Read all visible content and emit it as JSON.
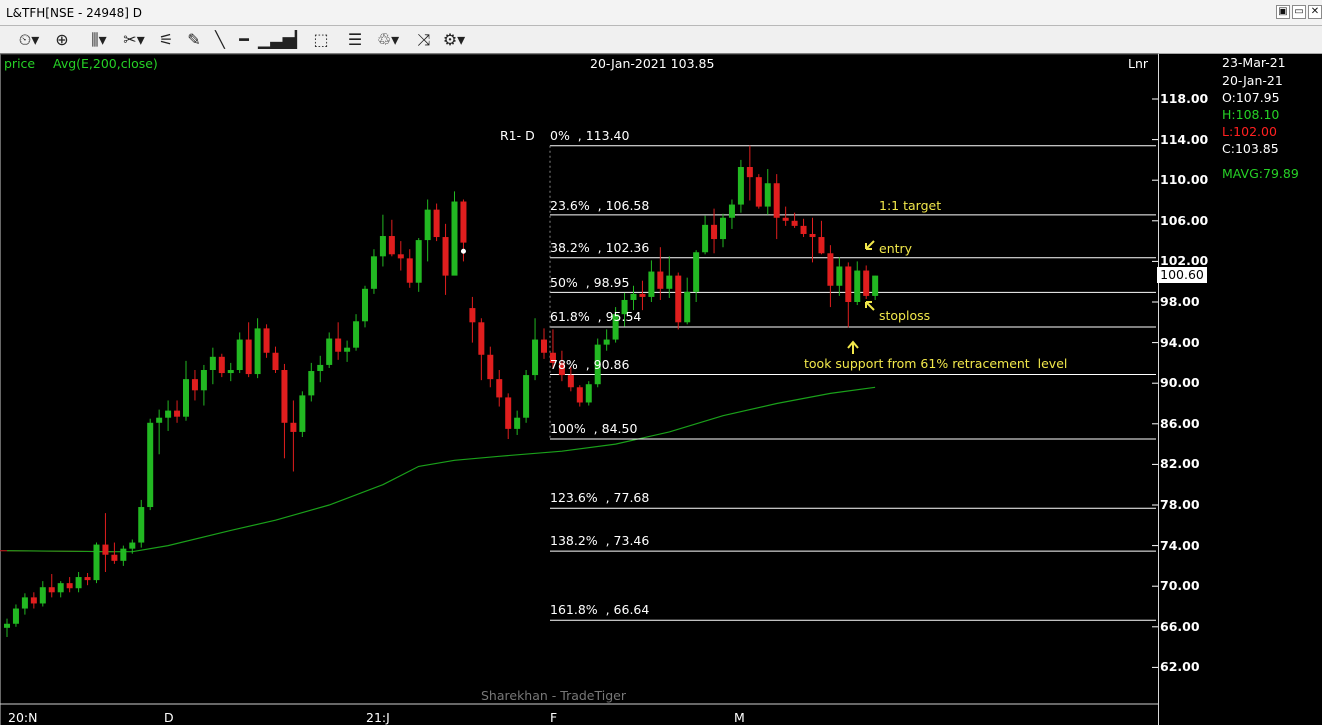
{
  "window": {
    "title": "L&TFH[NSE - 24948] D",
    "buttons": {
      "restore": "▣",
      "minimize": "▭",
      "close": "✕"
    }
  },
  "toolbar": {
    "icons": [
      "chart-style-icon",
      "crosshair-icon",
      "bar-type-icon",
      "line-tools-icon",
      "fibonacci-icon",
      "pen-icon",
      "segment-icon",
      "volume-bars-icon",
      "vertical-line-icon",
      "3d-box-icon",
      "horizontal-lines-icon",
      "draw-tools-icon",
      "compare-icon",
      "settings-gear-icon"
    ]
  },
  "header": {
    "price_label": "price",
    "indicator_label": "Avg(E,200,close)",
    "cursor_info": "20-Jan-2021 103.85",
    "scale_mode": "Lnr"
  },
  "info_panel": {
    "date1": "23-Mar-21",
    "date2": "20-Jan-21",
    "open": "O:107.95",
    "high": "H:108.10",
    "low": "L:102.00",
    "close": "C:103.85",
    "mavg": "MAVG:79.89"
  },
  "current_price_tag": "100.60",
  "watermark": "Sharekhan - TradeTiger",
  "colors": {
    "up": "#22b822",
    "down": "#e01e1e",
    "mavg": "#1aa01a",
    "annotation": "#f2e84b",
    "fib_line": "#ffffff"
  },
  "chart_data": {
    "type": "candlestick",
    "symbol": "L&TFH",
    "y_axis": {
      "ticks": [
        "118.00",
        "114.00",
        "110.00",
        "106.00",
        "102.00",
        "98.00",
        "94.00",
        "90.00",
        "86.00",
        "82.00",
        "78.00",
        "74.00",
        "70.00",
        "66.00",
        "62.00"
      ],
      "ylim": [
        59,
        122
      ]
    },
    "x_axis": {
      "labels": [
        "20:N",
        "D",
        "21:J",
        "F",
        "M"
      ]
    },
    "fibonacci": {
      "label": "R1- D",
      "levels": [
        {
          "text": "0%  , 113.40",
          "value": 113.4
        },
        {
          "text": "23.6%  , 106.58",
          "value": 106.58
        },
        {
          "text": "38.2%  , 102.36",
          "value": 102.36
        },
        {
          "text": "50%  , 98.95",
          "value": 98.95
        },
        {
          "text": "61.8%  , 95.54",
          "value": 95.54
        },
        {
          "text": "78%  , 90.86",
          "value": 90.86
        },
        {
          "text": "100%  , 84.50",
          "value": 84.5
        },
        {
          "text": "123.6%  , 77.68",
          "value": 77.68
        },
        {
          "text": "138.2%  , 73.46",
          "value": 73.46
        },
        {
          "text": "161.8%  , 66.64",
          "value": 66.64
        }
      ]
    },
    "annotations": [
      {
        "text": "1:1 target",
        "value": 106.58
      },
      {
        "text": "entry",
        "value": 102.36
      },
      {
        "text": "stoploss",
        "value": 95.54
      },
      {
        "text": "took support from 61% retracement  level",
        "value": 93.0
      }
    ],
    "candles": [
      [
        65.9,
        66.8,
        65.0,
        66.3
      ],
      [
        66.3,
        68.2,
        66.0,
        67.8
      ],
      [
        67.8,
        69.3,
        67.2,
        68.9
      ],
      [
        68.9,
        69.4,
        67.8,
        68.3
      ],
      [
        68.3,
        70.5,
        68.0,
        69.9
      ],
      [
        69.9,
        71.2,
        68.9,
        69.4
      ],
      [
        69.4,
        70.5,
        68.9,
        70.3
      ],
      [
        70.3,
        70.9,
        69.4,
        69.8
      ],
      [
        69.8,
        71.4,
        69.4,
        70.9
      ],
      [
        70.9,
        71.3,
        70.1,
        70.6
      ],
      [
        70.6,
        74.3,
        70.3,
        74.1
      ],
      [
        74.1,
        77.2,
        71.4,
        73.1
      ],
      [
        73.1,
        74.3,
        72.2,
        72.5
      ],
      [
        72.5,
        74.0,
        72.0,
        73.7
      ],
      [
        73.7,
        74.6,
        73.2,
        74.3
      ],
      [
        74.3,
        78.5,
        73.8,
        77.8
      ],
      [
        77.8,
        86.5,
        77.5,
        86.1
      ],
      [
        86.1,
        87.4,
        83.0,
        86.6
      ],
      [
        86.6,
        88.3,
        85.3,
        87.3
      ],
      [
        87.3,
        88.3,
        86.1,
        86.7
      ],
      [
        86.7,
        92.2,
        86.3,
        90.4
      ],
      [
        90.4,
        91.3,
        88.3,
        89.3
      ],
      [
        89.3,
        91.8,
        87.8,
        91.3
      ],
      [
        91.3,
        93.5,
        89.9,
        92.6
      ],
      [
        92.6,
        92.9,
        90.6,
        91.0
      ],
      [
        91.0,
        92.0,
        90.2,
        91.3
      ],
      [
        91.3,
        95.0,
        91.0,
        94.3
      ],
      [
        94.3,
        96.0,
        90.6,
        90.9
      ],
      [
        90.9,
        96.4,
        90.5,
        95.4
      ],
      [
        95.4,
        95.8,
        92.5,
        93.0
      ],
      [
        93.0,
        93.6,
        91.0,
        91.3
      ],
      [
        91.3,
        91.9,
        82.6,
        86.1
      ],
      [
        86.1,
        88.3,
        81.3,
        85.2
      ],
      [
        85.2,
        89.2,
        84.7,
        88.8
      ],
      [
        88.8,
        92.0,
        88.2,
        91.2
      ],
      [
        91.2,
        92.7,
        90.1,
        91.8
      ],
      [
        91.8,
        95.0,
        91.5,
        94.4
      ],
      [
        94.4,
        96.0,
        92.3,
        93.1
      ],
      [
        93.1,
        94.2,
        92.1,
        93.5
      ],
      [
        93.5,
        96.8,
        93.2,
        96.1
      ],
      [
        96.1,
        99.6,
        95.5,
        99.3
      ],
      [
        99.3,
        103.2,
        98.8,
        102.5
      ],
      [
        102.5,
        106.6,
        101.5,
        104.5
      ],
      [
        104.5,
        106.1,
        102.5,
        102.7
      ],
      [
        102.7,
        104.0,
        101.1,
        102.3
      ],
      [
        102.3,
        103.2,
        99.4,
        99.9
      ],
      [
        99.9,
        104.3,
        99.0,
        104.1
      ],
      [
        104.1,
        108.1,
        102.0,
        107.1
      ],
      [
        107.1,
        107.7,
        104.0,
        104.4
      ],
      [
        104.4,
        105.7,
        98.7,
        100.6
      ],
      [
        100.6,
        108.9,
        101.7,
        107.9
      ],
      [
        107.9,
        108.1,
        102.0,
        103.85
      ],
      [
        97.4,
        98.5,
        94.0,
        96.0
      ],
      [
        96.0,
        96.4,
        90.3,
        92.8
      ],
      [
        92.8,
        93.6,
        89.6,
        90.4
      ],
      [
        90.4,
        91.3,
        87.7,
        88.6
      ],
      [
        88.6,
        89.0,
        84.5,
        85.5
      ],
      [
        85.5,
        87.3,
        84.9,
        86.6
      ],
      [
        86.6,
        91.3,
        86.1,
        90.8
      ],
      [
        90.8,
        96.4,
        90.3,
        94.3
      ],
      [
        94.3,
        95.4,
        92.4,
        93.0
      ],
      [
        93.0,
        95.3,
        91.4,
        92.0
      ],
      [
        92.0,
        93.2,
        90.2,
        90.8
      ],
      [
        90.8,
        91.6,
        89.2,
        89.6
      ],
      [
        89.6,
        89.8,
        87.7,
        88.1
      ],
      [
        88.1,
        90.2,
        87.8,
        89.9
      ],
      [
        89.9,
        94.4,
        89.6,
        93.8
      ],
      [
        93.8,
        95.3,
        93.2,
        94.3
      ],
      [
        94.3,
        97.5,
        94.0,
        96.8
      ],
      [
        96.8,
        98.9,
        95.6,
        98.2
      ],
      [
        98.2,
        99.6,
        97.2,
        98.8
      ],
      [
        98.8,
        100.1,
        97.2,
        98.5
      ],
      [
        98.5,
        102.1,
        98.0,
        101.0
      ],
      [
        101.0,
        103.4,
        98.2,
        99.3
      ],
      [
        99.3,
        102.5,
        98.4,
        100.6
      ],
      [
        100.6,
        100.9,
        95.3,
        96.0
      ],
      [
        96.0,
        100.4,
        95.8,
        99.0
      ],
      [
        99.0,
        103.1,
        98.0,
        102.9
      ],
      [
        102.9,
        106.5,
        102.7,
        105.6
      ],
      [
        105.6,
        107.2,
        102.8,
        104.2
      ],
      [
        104.2,
        106.7,
        103.4,
        106.3
      ],
      [
        106.3,
        108.1,
        105.2,
        107.6
      ],
      [
        107.6,
        112.0,
        106.8,
        111.3
      ],
      [
        111.3,
        113.4,
        108.0,
        110.3
      ],
      [
        110.3,
        110.6,
        107.2,
        107.4
      ],
      [
        107.4,
        111.1,
        106.6,
        109.7
      ],
      [
        109.7,
        110.6,
        104.2,
        106.3
      ],
      [
        106.3,
        107.4,
        105.5,
        106.0
      ],
      [
        106.0,
        106.8,
        105.3,
        105.5
      ],
      [
        105.5,
        106.2,
        104.4,
        104.7
      ],
      [
        104.7,
        106.3,
        101.9,
        104.4
      ],
      [
        104.4,
        106.0,
        102.7,
        102.8
      ],
      [
        102.8,
        103.6,
        97.5,
        99.6
      ],
      [
        99.6,
        102.4,
        98.6,
        101.5
      ],
      [
        101.5,
        101.9,
        95.5,
        98.0
      ],
      [
        98.0,
        102.0,
        97.7,
        101.1
      ],
      [
        101.1,
        101.6,
        98.3,
        98.6
      ],
      [
        98.6,
        100.6,
        98.2,
        100.6
      ]
    ],
    "moving_average": {
      "name": "MAVG",
      "values": [
        [
          0,
          73.5
        ],
        [
          12,
          73.4
        ],
        [
          14,
          73.4
        ],
        [
          18,
          74.0
        ],
        [
          25,
          75.5
        ],
        [
          30,
          76.5
        ],
        [
          36,
          78.0
        ],
        [
          42,
          80.0
        ],
        [
          46,
          81.8
        ],
        [
          50,
          82.4
        ],
        [
          55,
          82.8
        ],
        [
          62,
          83.3
        ],
        [
          68,
          84.0
        ],
        [
          74,
          85.2
        ],
        [
          80,
          86.8
        ],
        [
          86,
          88.0
        ],
        [
          92,
          89.0
        ],
        [
          97,
          89.6
        ]
      ]
    }
  }
}
